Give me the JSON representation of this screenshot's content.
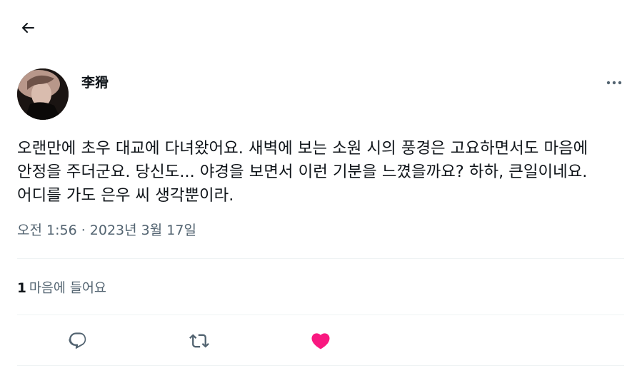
{
  "header": {
    "back_icon": "arrow-left-icon"
  },
  "tweet": {
    "author_name": "李猾",
    "more_icon": "more-horizontal-icon",
    "text": "오랜만에 초우 대교에 다녀왔어요. 새벽에 보는 소원 시의 풍경은 고요하면서도 마음에 안정을 주더군요. 당신도... 야경을 보면서 이런 기분을 느꼈을까요? 하하, 큰일이네요. 어디를 가도 은우 씨 생각뿐이라.",
    "timestamp": "오전 1:56 · 2023년 3월 17일",
    "likes_count": "1",
    "likes_label": "마음에 들어요"
  },
  "actions": {
    "reply_icon": "reply-icon",
    "retweet_icon": "retweet-icon",
    "like_icon": "heart-icon",
    "like_color": "#f91880",
    "icon_color": "#536471"
  }
}
